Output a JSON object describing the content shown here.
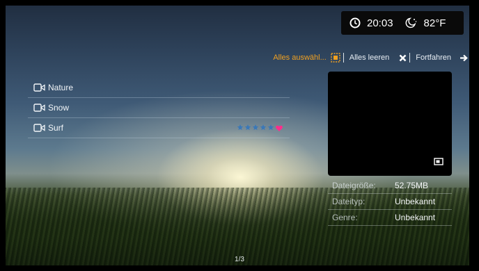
{
  "clock": {
    "time": "20:03",
    "temperature": "82°F"
  },
  "toolbar": {
    "select_all": "Alles auswähl...",
    "clear_all": "Alles leeren",
    "continue": "Fortfahren"
  },
  "files": [
    {
      "name": "Nature",
      "rating": null,
      "favorite": false
    },
    {
      "name": "Snow",
      "rating": null,
      "favorite": false
    },
    {
      "name": "Surf",
      "rating": 0,
      "favorite": true
    }
  ],
  "details": [
    {
      "key": "Dateigröße:",
      "value": "52.75MB"
    },
    {
      "key": "Dateityp:",
      "value": "Unbekannt"
    },
    {
      "key": "Genre:",
      "value": "Unbekannt"
    }
  ],
  "pager": "1/3",
  "colors": {
    "accent_orange": "#f0a020",
    "favorite_pink": "#ff2d8c",
    "star_blue": "#3a78b8"
  },
  "icons": {
    "clock": "clock-icon",
    "weather": "moon-night-icon",
    "select": "selection-icon",
    "clear": "x-icon",
    "next": "arrow-right-icon",
    "video": "video-camera-icon"
  }
}
